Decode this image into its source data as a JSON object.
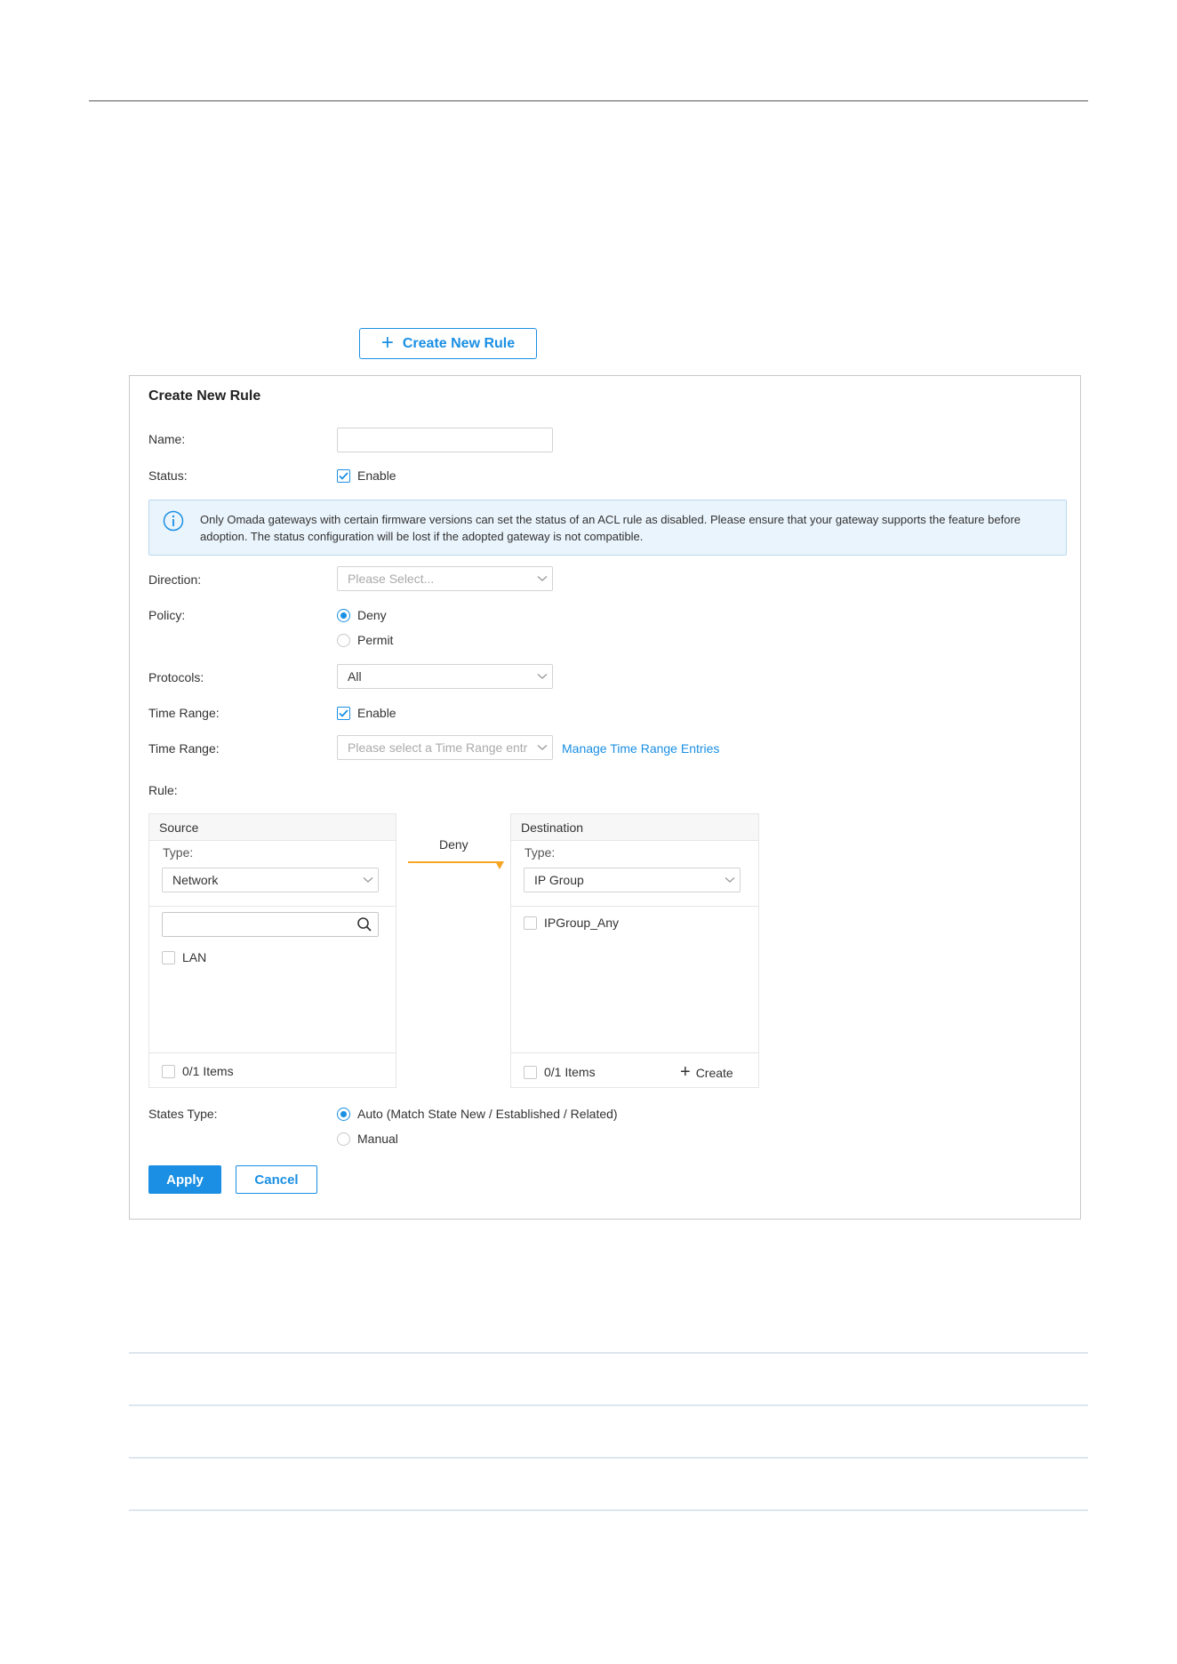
{
  "top_button": {
    "label": "Create New Rule"
  },
  "form": {
    "title": "Create New Rule",
    "name": {
      "label": "Name:",
      "value": ""
    },
    "status": {
      "label": "Status:",
      "option": "Enable",
      "checked": true
    },
    "notice": "Only Omada gateways with certain firmware versions can set the status of an ACL rule as disabled. Please ensure that your gateway supports the feature before adoption. The status configuration will be lost if the adopted gateway is not compatible.",
    "direction": {
      "label": "Direction:",
      "placeholder": "Please Select..."
    },
    "policy": {
      "label": "Policy:",
      "options": [
        "Deny",
        "Permit"
      ],
      "selected": "Deny"
    },
    "protocols": {
      "label": "Protocols:",
      "value": "All"
    },
    "time_range_enable": {
      "label": "Time Range:",
      "option": "Enable",
      "checked": true
    },
    "time_range": {
      "label": "Time Range:",
      "placeholder": "Please select a Time Range entr",
      "link": "Manage Time Range Entries"
    },
    "rule": {
      "label": "Rule:",
      "source": {
        "title": "Source",
        "type_label": "Type:",
        "type_value": "Network",
        "search_value": "",
        "items": [
          "LAN"
        ],
        "footer": "0/1 Items"
      },
      "action": "Deny",
      "destination": {
        "title": "Destination",
        "type_label": "Type:",
        "type_value": "IP Group",
        "items": [
          "IPGroup_Any"
        ],
        "footer": "0/1 Items",
        "create_label": "Create"
      }
    },
    "states_type": {
      "label": "States Type:",
      "options": [
        "Auto (Match State New / Established / Related)",
        "Manual"
      ],
      "selected": "Auto (Match State New / Established / Related)"
    },
    "apply_label": "Apply",
    "cancel_label": "Cancel"
  },
  "colors": {
    "accent": "#1a8fe3",
    "flow_arrow": "#f5a623",
    "notice_bg": "#eaf4fc"
  }
}
